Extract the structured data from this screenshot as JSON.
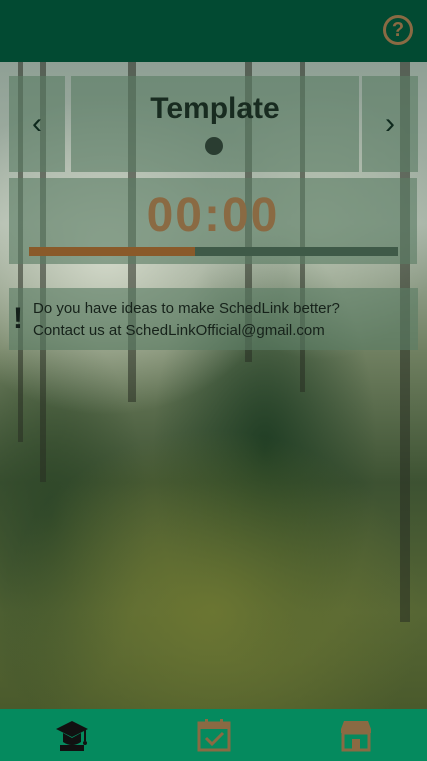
{
  "header": {
    "help_label": "?",
    "help_icon": "help-circle-icon"
  },
  "template": {
    "prev_label": "‹",
    "next_label": "›",
    "title": "Template"
  },
  "timer": {
    "time": "00:00",
    "progress": 0.45
  },
  "notice": {
    "icon": "!",
    "line1": "Do you have ideas to make SchedLink better?",
    "line2": "Contact us at SchedLinkOfficial@gmail.com"
  },
  "bottom_nav": {
    "items": [
      {
        "name": "graduation-icon",
        "active": true
      },
      {
        "name": "calendar-check-icon",
        "active": false
      },
      {
        "name": "store-icon",
        "active": false
      }
    ]
  },
  "colors": {
    "top_bar": "#024a32",
    "bottom_bar": "#058a5e",
    "accent": "#8a6a43"
  }
}
